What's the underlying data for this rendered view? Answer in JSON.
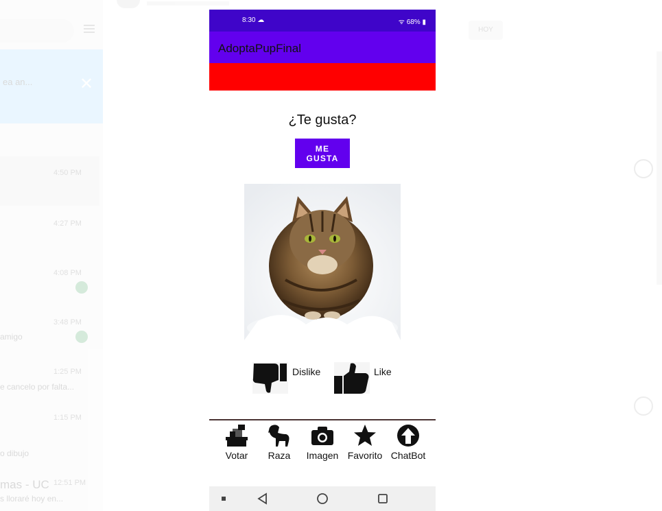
{
  "background_app": {
    "banner_text": "ea an...",
    "times": [
      "4:50 PM",
      "4:27 PM",
      "4:08 PM",
      "3:48 PM",
      "1:25 PM",
      "1:15 PM",
      "12:51 PM"
    ],
    "snippets": [
      "amigo",
      "e cancelo por falta...",
      "o dibujo",
      "s lloraré hoy en..."
    ],
    "title_snippet": "mas - UC",
    "chip_label": "HOY"
  },
  "status": {
    "time": "8:30",
    "battery": "68%"
  },
  "app": {
    "title": "AdoptaPupFinal",
    "question": "¿Te gusta?",
    "main_button_label": "ME GUSTA"
  },
  "image": {
    "subject": "cat-photo"
  },
  "vote": {
    "dislike_label": "Dislike",
    "like_label": "Like"
  },
  "bottom_nav": [
    {
      "label": "Votar",
      "icon": "ballot-box-icon"
    },
    {
      "label": "Raza",
      "icon": "dog-icon"
    },
    {
      "label": "Imagen",
      "icon": "camera-icon"
    },
    {
      "label": "Favorito",
      "icon": "star-icon"
    },
    {
      "label": "ChatBot",
      "icon": "upload-arrow-icon"
    }
  ],
  "colors": {
    "status_bar": "#3f05c9",
    "app_bar": "#6200ee",
    "red_band": "#ff0000",
    "button": "#6200ee"
  }
}
